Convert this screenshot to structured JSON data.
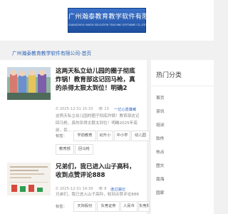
{
  "site": {
    "logo_title": "广州瀚泰教育教学软件有限公司",
    "logo_subtitle": "GUANGZHOU HANTAI EDUCATION TEACHING SOFTWARE CO.,LTD",
    "logo_color": "#2a5fb4"
  },
  "breadcrumb": {
    "text": "广州瀚泰教育教学软件有限公司-首页"
  },
  "articles": [
    {
      "title": "这两天私立幼儿园的圈子彻底炸锅！教育部这记回马枪，真的杀得太狠太到位！明确2",
      "date": "2025-12-31 15:33",
      "date_icon": "clock-icon",
      "views": "13",
      "views_icon": "eye-icon",
      "link": "一亿心愿廉臧",
      "excerpt": "这两天私立幼儿园的圈子彻底炸锅！教育部这记回马枪，真的杀得太狠太到位！明确2025年底前，民...",
      "tag_label": "标签：",
      "tags": [
        "学前教育",
        "幼升小",
        "中小学",
        "幼儿园",
        "教育部",
        "回马枪"
      ]
    },
    {
      "title": "兄弟们，我已进入山子高科，收到点赞评论888",
      "date": "2025-12-31 14:39",
      "date_icon": "clock-icon",
      "views": "8",
      "views_icon": "eye-icon",
      "link": "连过湖记",
      "excerpt": "兄弟们，我已进入山子高科，收到点赞评论888",
      "tag_label": "标签：",
      "tags": [
        "天际股份",
        "东竞证券",
        "人民币",
        "东竞财富"
      ]
    }
  ],
  "sidebar": {
    "title": "热门分类",
    "items": [
      "首页",
      "资讯",
      "培训",
      "软件",
      "热点",
      "图文",
      "南海",
      "国家"
    ]
  }
}
